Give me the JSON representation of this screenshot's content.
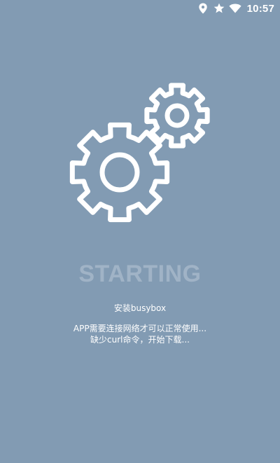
{
  "status_bar": {
    "time": "10:57",
    "icons": [
      "location-icon",
      "star-icon",
      "wifi-icon"
    ]
  },
  "main": {
    "title": "STARTING",
    "step": "安装busybox",
    "message_lines": [
      "APP需要连接网络才可以正常使用...",
      "缺少curl命令，开始下载..."
    ]
  },
  "colors": {
    "background": "#829bb3",
    "title": "#a0b3c6",
    "text": "#ffffff"
  }
}
